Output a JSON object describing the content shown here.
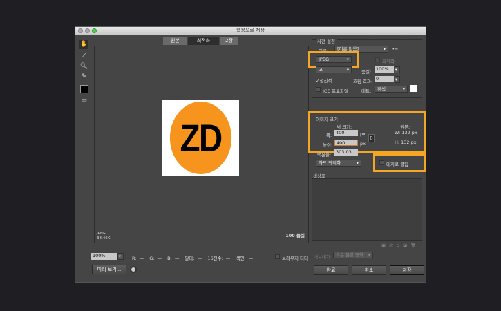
{
  "window": {
    "title": "웹용으로 저장"
  },
  "tabs": [
    {
      "label": "원본"
    },
    {
      "label": "최적화"
    },
    {
      "label": "2장"
    }
  ],
  "tools": [
    "hand-icon",
    "slice-select-icon",
    "zoom-icon",
    "eyedropper-icon",
    "color-swatch",
    "toggle-slices-icon"
  ],
  "image": {
    "text": "ZD",
    "circle_color": "#f7941d",
    "bg_color": "#ffffff"
  },
  "preview_info": {
    "format": "JPEG",
    "size": "38.46K",
    "quality": "100 품질"
  },
  "bottom": {
    "zoom": "100%",
    "r": "R: —",
    "g": "G: —",
    "b": "B: —",
    "alpha": "알파: —",
    "hex": "16진수: —",
    "index": "색인: —",
    "browser_dither": "브라우저 디더",
    "preview_button": "미리 보기..."
  },
  "preset": {
    "title": "사전 설정",
    "name_label": "이름:",
    "name_value": "[이름 없음]",
    "format": "JPEG",
    "optimized": "최적화",
    "quality_level": "고",
    "quality_label": "품질:",
    "quality_value": "100%",
    "progressive": "점진적",
    "blur_label": "흐림 효과:",
    "blur_value": "0",
    "icc": "ICC 프로파일",
    "matte_label": "매트:",
    "matte_value": "흰색"
  },
  "image_size": {
    "title": "이미지 크기",
    "new_size": "새 크기:",
    "width_label": "폭:",
    "width_value": "400",
    "height_label": "높이:",
    "height_value": "400",
    "unit": "px",
    "percent_label": "백분율:",
    "percent_value": "303.03",
    "original": "원본:",
    "orig_w": "W:  132 px",
    "orig_h": "H:  132 px",
    "quality_mode": "하드 최적화",
    "clip": "대지로 클립"
  },
  "color_table": {
    "title": "색상표"
  },
  "export": {
    "label": "내보내기:",
    "value": "모든 분할 영역"
  },
  "buttons": {
    "done": "완료",
    "cancel": "취소",
    "save": "저장"
  },
  "accent": "#f5a623"
}
